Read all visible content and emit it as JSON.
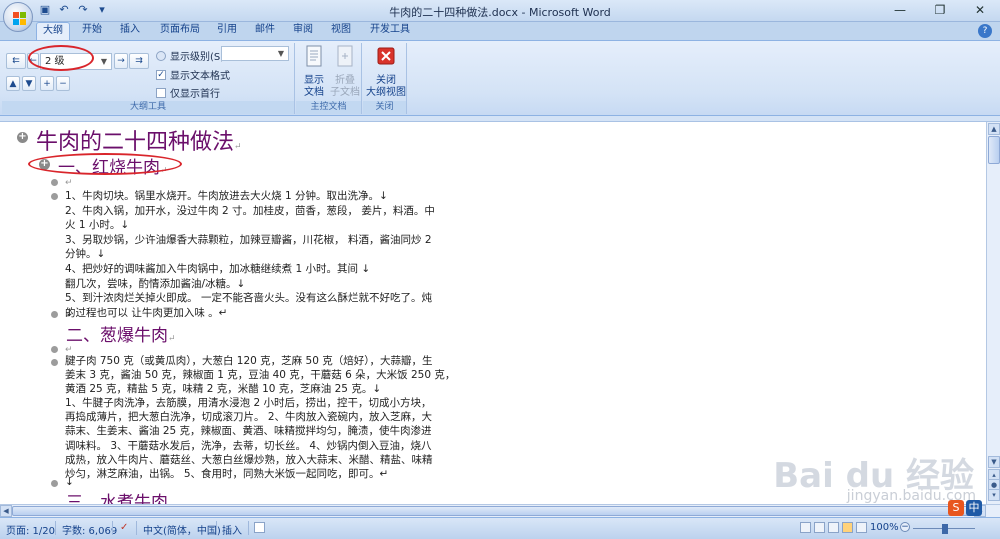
{
  "window": {
    "title": "牛肉的二十四种做法.docx - Microsoft Word",
    "min": "—",
    "restore": "❐",
    "close": "✕"
  },
  "qat": {
    "save": "▣",
    "undo": "↶",
    "redo": "↷",
    "more": "▾"
  },
  "tabs": [
    "大纲",
    "开始",
    "插入",
    "页面布局",
    "引用",
    "邮件",
    "审阅",
    "视图",
    "开发工具"
  ],
  "active_tab": "大纲",
  "ribbon": {
    "outline_tools": {
      "level_value": "2 级",
      "show_level_label": "显示级别(S):",
      "show_level_value": "",
      "show_text_format": "显示文本格式",
      "show_text_format_checked": true,
      "first_line_only": "仅显示首行",
      "first_line_only_checked": false,
      "group_label": "大纲工具"
    },
    "master_document": {
      "show_document": [
        "显示",
        "文档"
      ],
      "collapse_subdocs": [
        "折叠",
        "子文档"
      ],
      "group_label": "主控文档"
    },
    "close": {
      "close_view": [
        "关闭",
        "大纲视图"
      ],
      "group_label": "关闭"
    }
  },
  "document": {
    "h1": "牛肉的二十四种做法",
    "sections": [
      {
        "heading": "一、红烧牛肉",
        "paragraphs": [
          [
            ""
          ],
          [
            "1、牛肉切块。锅里水烧开。牛肉放进去大火烧 1 分钟。取出洗净。↓",
            "2、牛肉入锅，加开水，没过牛肉 2 寸。加桂皮，茴香，葱段， 姜片，料酒。中",
            "火 1 小时。↓",
            "3、另取炒锅，少许油爆香大蒜颗粒，加辣豆瓣酱，川花椒， 料酒，酱油同炒 2",
            "分钟。↓",
            "4、把炒好的调味酱加入牛肉锅中，加冰糖继续煮 1 小时。其间 ↓",
            "翻几次，尝味，酌情添加酱油/冰糖。↓",
            "5、到汁浓肉烂关掉火即成。 一定不能吝啬火头。没有这么酥烂就不好吃了。炖",
            "的过程也可以 让牛肉更加入味 。↵"
          ],
          [
            "↓"
          ]
        ]
      },
      {
        "heading": "二、葱爆牛肉",
        "paragraphs": [
          [
            ""
          ],
          [
            "腱子肉 750 克（或黄瓜肉），大葱白 120 克，芝麻 50 克（焙好），大蒜瓣，生",
            "姜末 3 克，酱油 50 克，辣椒面 1 克，豆油 40 克，干蘑菇 6 朵，大米饭 250 克，",
            "黄酒 25 克，精盐 5 克，味精 2 克，米醋 10 克，芝麻油 25 克。↓",
            "1、牛腱子肉洗净，去筋膜，用清水浸泡 2 小时后，捞出，控干，切成小方块，",
            "再捣成薄片，把大葱白洗净，切成滚刀片。 2、牛肉放入瓷碗内，放入芝麻，大",
            "蒜末、生姜末、酱油 25 克，辣椒面、黄酒、味精搅拌均匀，腌渍，使牛肉渗进",
            "调味料。 3、干蘑菇水发后，洗净，去蒂，切长丝。 4、炒锅内倒入豆油，烧八",
            "成热，放入牛肉片、蘑菇丝、大葱白丝爆炒熟，放入大蒜末、米醋、精盐、味精",
            "炒匀，淋芝麻油，出锅。 5、食用时，同熟大米饭一起同吃，即可。↵"
          ],
          [
            "↓"
          ]
        ]
      },
      {
        "heading": "三、水煮牛肉",
        "paragraphs": []
      }
    ]
  },
  "statusbar": {
    "page": "页面: 1/20",
    "words": "字数: 6,069",
    "language": "中文(简体，中国)",
    "mode": "插入",
    "zoom": "100%"
  },
  "watermark": {
    "logo": "Bai du 经验",
    "url": "jingyan.baidu.com"
  },
  "colors": {
    "heading": "#6b0f6b",
    "annotation": "#d9252b",
    "ribbon": "#dbe8f8"
  }
}
